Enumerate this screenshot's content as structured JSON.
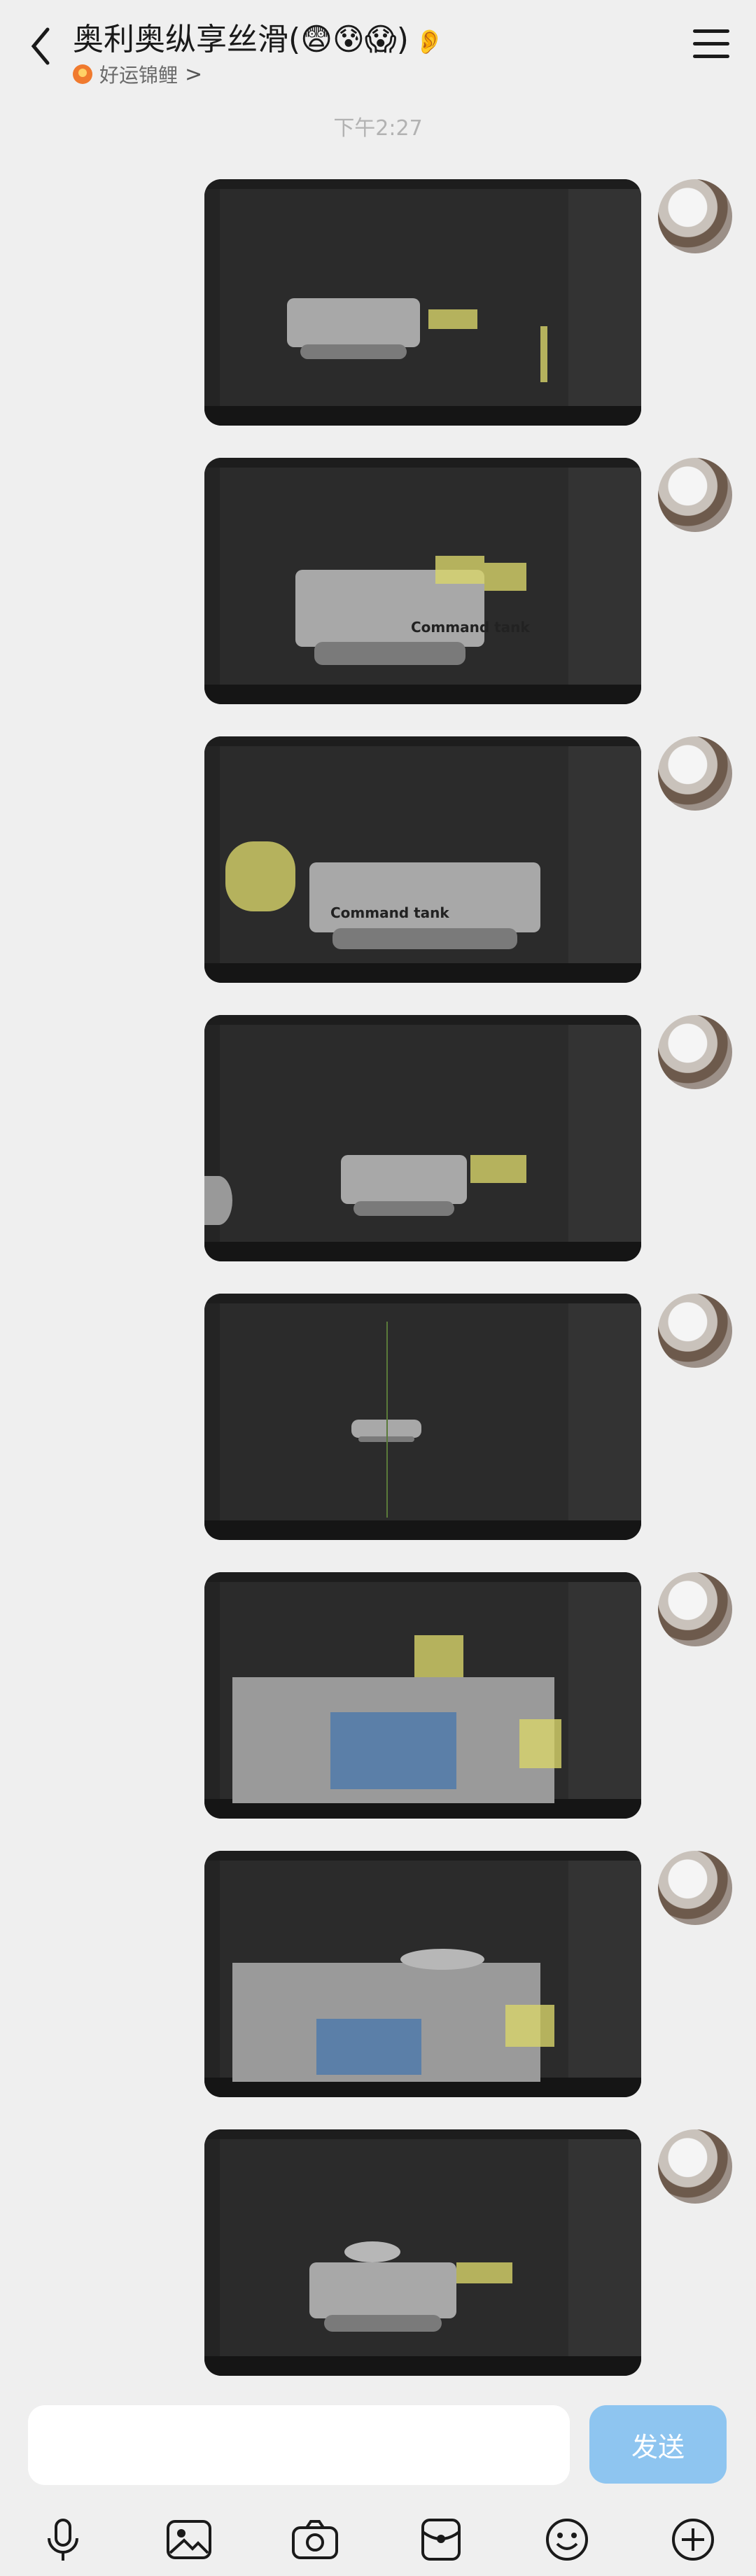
{
  "header": {
    "title": "奥利奥纵享丝滑(😨😰😱)",
    "subtitle": "好运锦鲤",
    "chevron": ">"
  },
  "timestamp": "下午2:27",
  "messages": [
    {
      "label": ""
    },
    {
      "label": "Command tank"
    },
    {
      "label": "Command tank"
    },
    {
      "label": ""
    },
    {
      "label": ""
    },
    {
      "label": ""
    },
    {
      "label": ""
    },
    {
      "label": ""
    }
  ],
  "composer": {
    "placeholder": "",
    "send_label": "发送"
  },
  "icons": [
    "mic-icon",
    "image-icon",
    "camera-icon",
    "red-packet-icon",
    "emoji-icon",
    "plus-icon"
  ],
  "colors": {
    "send_button": "#8ec5f0",
    "background": "#efefef"
  }
}
